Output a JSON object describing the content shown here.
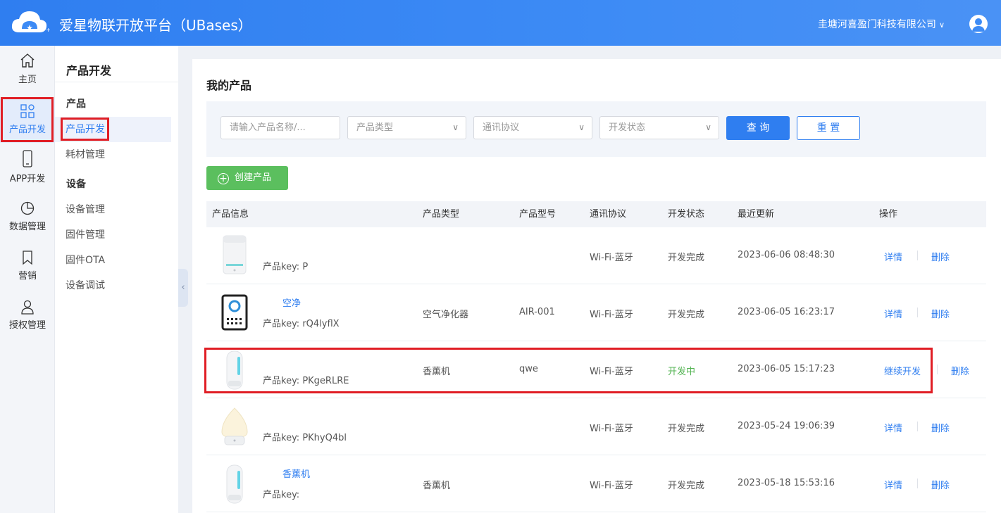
{
  "header": {
    "title": "爱星物联开放平台（UBases）",
    "company": "圭塘河喜盈门科技有限公司",
    "company_chevron": "∨"
  },
  "rail": {
    "items": [
      {
        "label": "主页",
        "icon": "home-icon"
      },
      {
        "label": "产品开发",
        "icon": "grid-icon",
        "active": true
      },
      {
        "label": "APP开发",
        "icon": "phone-icon"
      },
      {
        "label": "数据管理",
        "icon": "pie-chart-icon"
      },
      {
        "label": "营销",
        "icon": "bookmark-icon"
      },
      {
        "label": "授权管理",
        "icon": "user-icon"
      }
    ]
  },
  "submenu": {
    "title": "产品开发",
    "group_product": "产品",
    "product_items": [
      "产品开发",
      "耗材管理"
    ],
    "group_device": "设备",
    "device_items": [
      "设备管理",
      "固件管理",
      "固件OTA",
      "设备调试"
    ],
    "collapse_glyph": "‹"
  },
  "main": {
    "title": "我的产品",
    "filters": {
      "search_placeholder": "请输入产品名称/...",
      "type_placeholder": "产品类型",
      "protocol_placeholder": "通讯协议",
      "status_placeholder": "开发状态",
      "caret": "∨"
    },
    "query_button": "查 询",
    "reset_button": "重 置",
    "create_button": "创建产品",
    "create_plus": "+",
    "columns": [
      "产品信息",
      "产品类型",
      "产品型号",
      "通讯协议",
      "开发状态",
      "最近更新",
      "操作"
    ],
    "rows": [
      {
        "name": "",
        "key": "产品key: P",
        "type": "",
        "model": "",
        "protocol": "Wi-Fi-蓝牙",
        "status": "开发完成",
        "updated": "2023-06-06 08:48:30",
        "ops": [
          "详情",
          "删除"
        ],
        "thumb": "humidifier"
      },
      {
        "name": "空净",
        "key": "产品key: rQ4lyflX",
        "type": "空气净化器",
        "model": "AIR-001",
        "protocol": "Wi-Fi-蓝牙",
        "status": "开发完成",
        "updated": "2023-06-05 16:23:17",
        "ops": [
          "详情",
          "删除"
        ],
        "thumb": "purifier"
      },
      {
        "name": "",
        "key": "产品key: PKgeRLRE",
        "type": "香薰机",
        "model": "qwe",
        "protocol": "Wi-Fi-蓝牙",
        "status": "开发中",
        "updated": "2023-06-05 15:17:23",
        "ops": [
          "继续开发",
          "删除"
        ],
        "thumb": "diffuser"
      },
      {
        "name": "",
        "key": "产品key: PKhyQ4bl",
        "type": "",
        "model": "",
        "protocol": "Wi-Fi-蓝牙",
        "status": "开发完成",
        "updated": "2023-05-24 19:06:39",
        "ops": [
          "详情",
          "删除"
        ],
        "thumb": "aroma-lamp"
      },
      {
        "name": "香薰机",
        "key": "产品key:",
        "type": "香薰机",
        "model": "",
        "protocol": "Wi-Fi-蓝牙",
        "status": "开发完成",
        "updated": "2023-05-18 15:53:16",
        "ops": [
          "详情",
          "删除"
        ],
        "thumb": "diffuser"
      }
    ]
  },
  "colors": {
    "header": "#3d8bf5",
    "primary": "#2f7ef0",
    "create": "#5bbf5e",
    "in_dev": "#52b351",
    "highlight": "#e01e25"
  }
}
